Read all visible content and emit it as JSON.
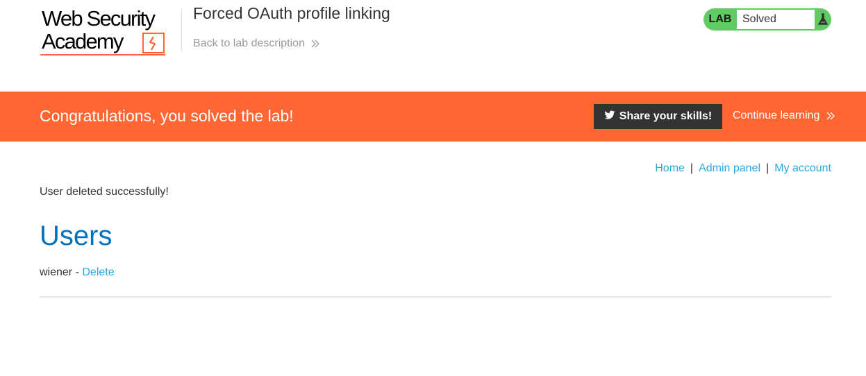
{
  "header": {
    "logo_line1": "Web Security",
    "logo_line2": "Academy",
    "lab_title": "Forced OAuth profile linking",
    "back_link": "Back to lab description"
  },
  "lab_status": {
    "badge": "LAB",
    "state": "Solved",
    "icon": "flask-icon",
    "badge_color": "#5fcb63"
  },
  "banner": {
    "message": "Congratulations, you solved the lab!",
    "share_label": "Share your skills!",
    "share_icon": "twitter-bird-icon",
    "continue_label": "Continue learning",
    "color": "#ff6633"
  },
  "nav": {
    "home": "Home",
    "admin_panel": "Admin panel",
    "my_account": "My account",
    "separator": "|"
  },
  "content": {
    "flash_message": "User deleted successfully!",
    "heading": "Users",
    "users": [
      {
        "name": "wiener",
        "separator": " - ",
        "action": "Delete"
      }
    ]
  },
  "colors": {
    "link": "#29a8df",
    "heading": "#0071bc"
  }
}
